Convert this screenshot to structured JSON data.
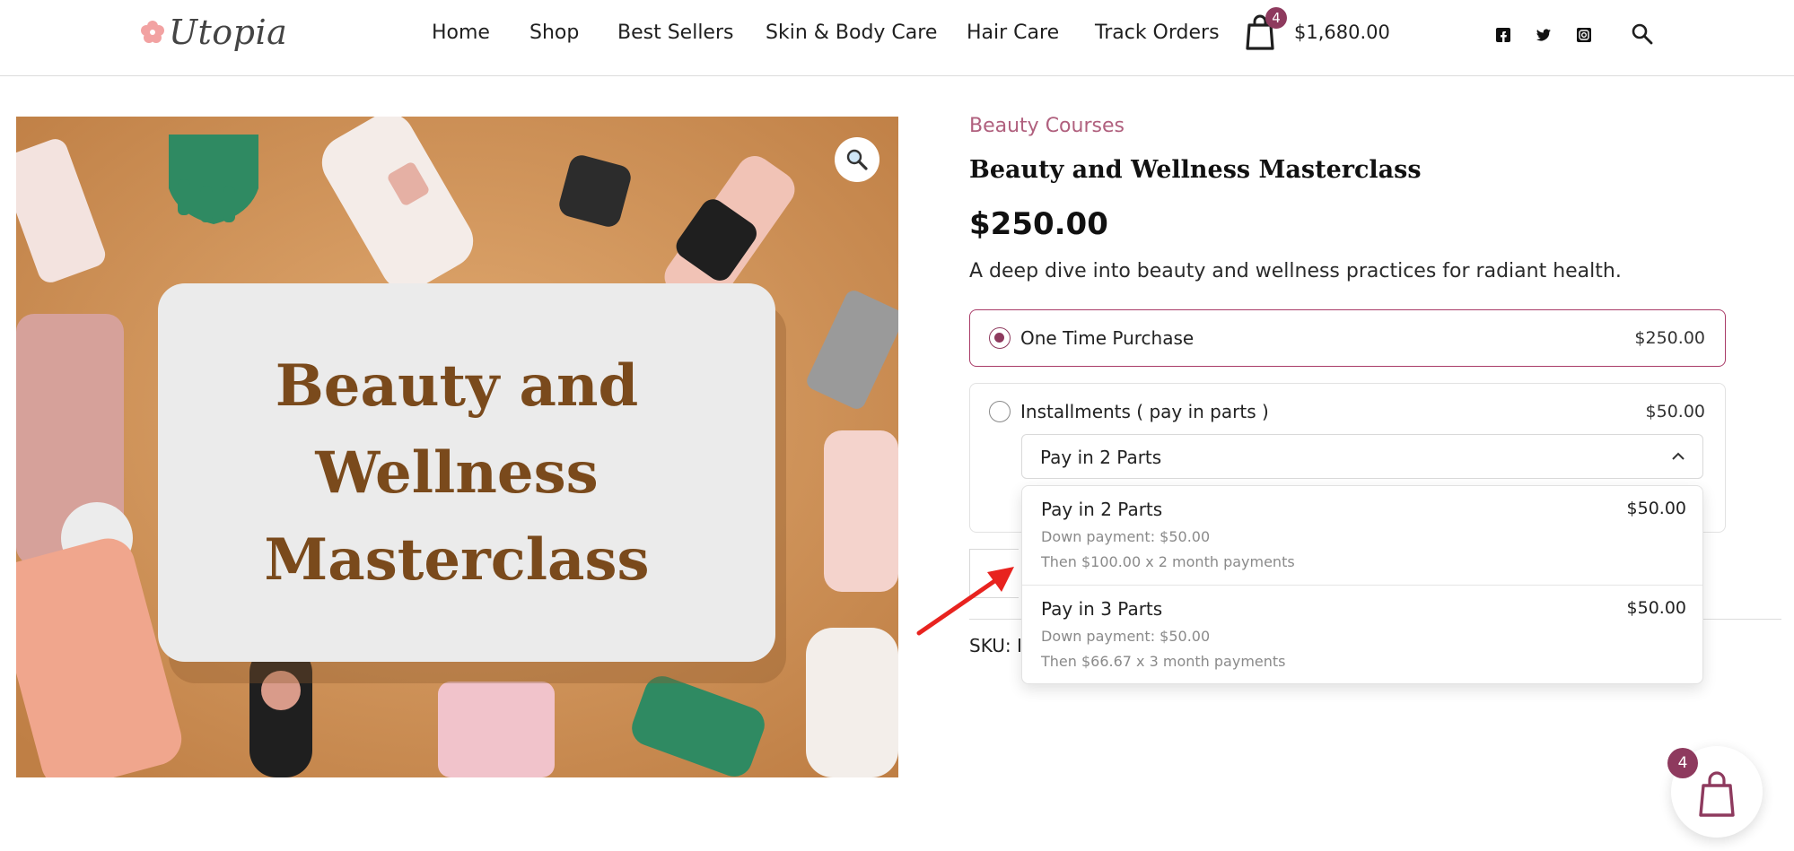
{
  "brand": {
    "name": "Utopia"
  },
  "nav": {
    "items": [
      "Home",
      "Shop",
      "Best Sellers",
      "Skin & Body Care",
      "Hair Care",
      "Track Orders"
    ]
  },
  "cart": {
    "count": "4",
    "total": "$1,680.00"
  },
  "social": [
    "facebook-icon",
    "twitter-icon",
    "instagram-icon"
  ],
  "image": {
    "card_title": "Beauty and Wellness Masterclass"
  },
  "product": {
    "category": "Beauty Courses",
    "title": "Beauty and Wellness Masterclass",
    "price": "$250.00",
    "description": "A deep dive into beauty and wellness practices for radiant health.",
    "sku_label": "SKU: II"
  },
  "purchase_options": {
    "one_time": {
      "label": "One Time Purchase",
      "price": "$250.00",
      "selected": true
    },
    "installments": {
      "label": "Installments ( pay in parts )",
      "price": "$50.00",
      "selected": false
    }
  },
  "plan_select": {
    "value": "Pay in 2 Parts",
    "options": [
      {
        "name": "Pay in 2 Parts",
        "price": "$50.00",
        "down": "Down payment: $50.00",
        "then": "Then $100.00 x 2 month payments"
      },
      {
        "name": "Pay in 3 Parts",
        "price": "$50.00",
        "down": "Down payment: $50.00",
        "then": "Then $66.67 x 3 month payments"
      }
    ]
  },
  "floating_cart": {
    "count": "4"
  },
  "colors": {
    "accent": "#8e3a5e",
    "category": "#b0607e",
    "arrow": "#e8231f",
    "image_bg": "#cf955b"
  }
}
